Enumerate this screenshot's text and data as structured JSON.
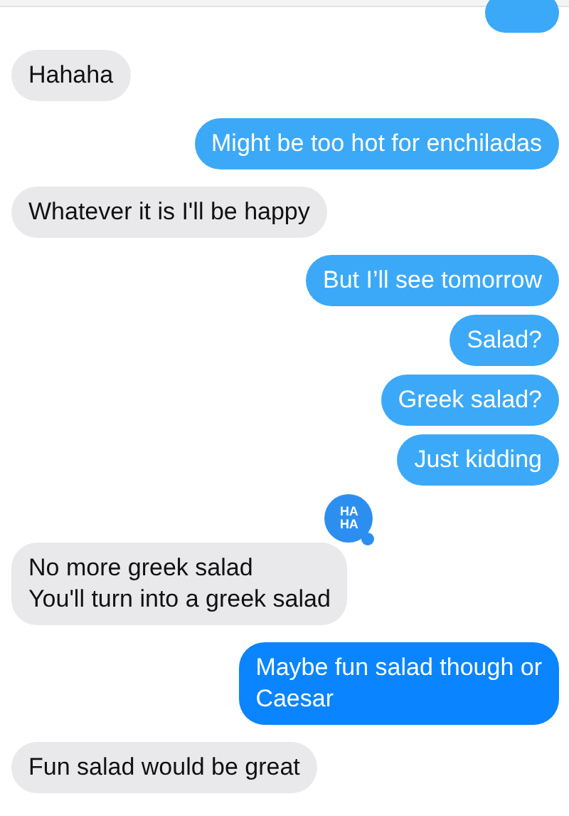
{
  "messages": [
    {
      "kind": "sent_cut",
      "color": "#3ba9f7"
    },
    {
      "kind": "received",
      "text": "Hahaha"
    },
    {
      "kind": "sent",
      "color": "#3ba9f7",
      "text": "Might be too hot for enchiladas"
    },
    {
      "kind": "received",
      "text": "Whatever it is I'll be happy"
    },
    {
      "kind": "sent",
      "color": "#3ba9f7",
      "text": "But I’ll see tomorrow"
    },
    {
      "kind": "sent",
      "color": "#3ba9f7",
      "text": "Salad?"
    },
    {
      "kind": "sent",
      "color": "#3ba9f7",
      "text": "Greek salad?"
    },
    {
      "kind": "sent",
      "color": "#3ba9f7",
      "text": "Just kidding"
    },
    {
      "kind": "received",
      "text": "No more greek salad\nYou'll turn into a greek salad",
      "tapback": {
        "kind": "haha",
        "label": [
          "HA",
          "HA"
        ]
      }
    },
    {
      "kind": "sent",
      "color": "#0a84ff",
      "text": "Maybe fun salad though or\nCaesar"
    },
    {
      "kind": "received",
      "text": "Fun salad would be great"
    }
  ]
}
